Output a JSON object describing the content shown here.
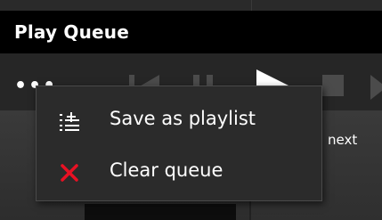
{
  "window": {
    "title": "Play Queue"
  },
  "toolbar": {
    "more_label": "•••"
  },
  "content": {
    "next_label": "next"
  },
  "context_menu": {
    "items": [
      {
        "label": "Save as playlist",
        "icon": "save-playlist-icon"
      },
      {
        "label": "Clear queue",
        "icon": "close-x-icon",
        "icon_color": "#e81123"
      }
    ]
  },
  "colors": {
    "title_bar": "#000000",
    "menu_background": "#2b2b2b",
    "accent_red": "#e81123",
    "text": "#ffffff"
  }
}
